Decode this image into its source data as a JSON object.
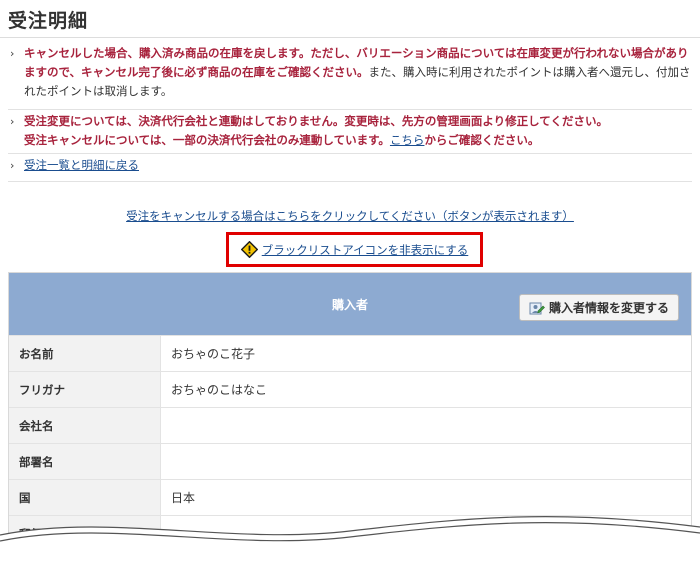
{
  "page": {
    "title": "受注明細"
  },
  "notices": {
    "n1": {
      "chevron": "›",
      "red": "キャンセルした場合、購入済み商品の在庫を戻します。ただし、バリエーション商品については在庫変更が行われない場合がありますので、キャンセル完了後に必ず商品の在庫をご確認ください。",
      "dark": "また、購入時に利用されたポイントは購入者へ還元し、付加されたポイントは取消します。"
    },
    "n2": {
      "chevron": "›",
      "line1": "受注変更については、決済代行会社と連動はしておりません。変更時は、先方の管理画面より修正してください。",
      "line2_pre": "受注キャンセルについては、一部の決済代行会社のみ連動しています。",
      "line2_link": "こちら",
      "line2_post": "からご確認ください。"
    },
    "n3": {
      "chevron": "›",
      "link": "受注一覧と明細に戻る"
    }
  },
  "actions": {
    "cancel_link": "受注をキャンセルする場合はこちらをクリックしてください（ボタンが表示されます）",
    "blacklist_link": "ブラックリストアイコンを非表示にする"
  },
  "buyer": {
    "header": "購入者",
    "change_button": "購入者情報を変更する",
    "rows": [
      {
        "label": "お名前",
        "value": "おちゃのこ花子"
      },
      {
        "label": "フリガナ",
        "value": "おちゃのこはなこ"
      },
      {
        "label": "会社名",
        "value": ""
      },
      {
        "label": "部署名",
        "value": ""
      },
      {
        "label": "国",
        "value": "日本"
      },
      {
        "label": "郵便番号",
        "value": ""
      }
    ]
  },
  "colors": {
    "accent_red": "#a8233d",
    "link_blue": "#1a4d8f",
    "header_blue": "#8daad1",
    "highlight_border": "#e00000"
  },
  "icons": {
    "warning": "warning-icon",
    "edit_user": "edit-user-icon",
    "chevron": "chevron-right-icon"
  }
}
